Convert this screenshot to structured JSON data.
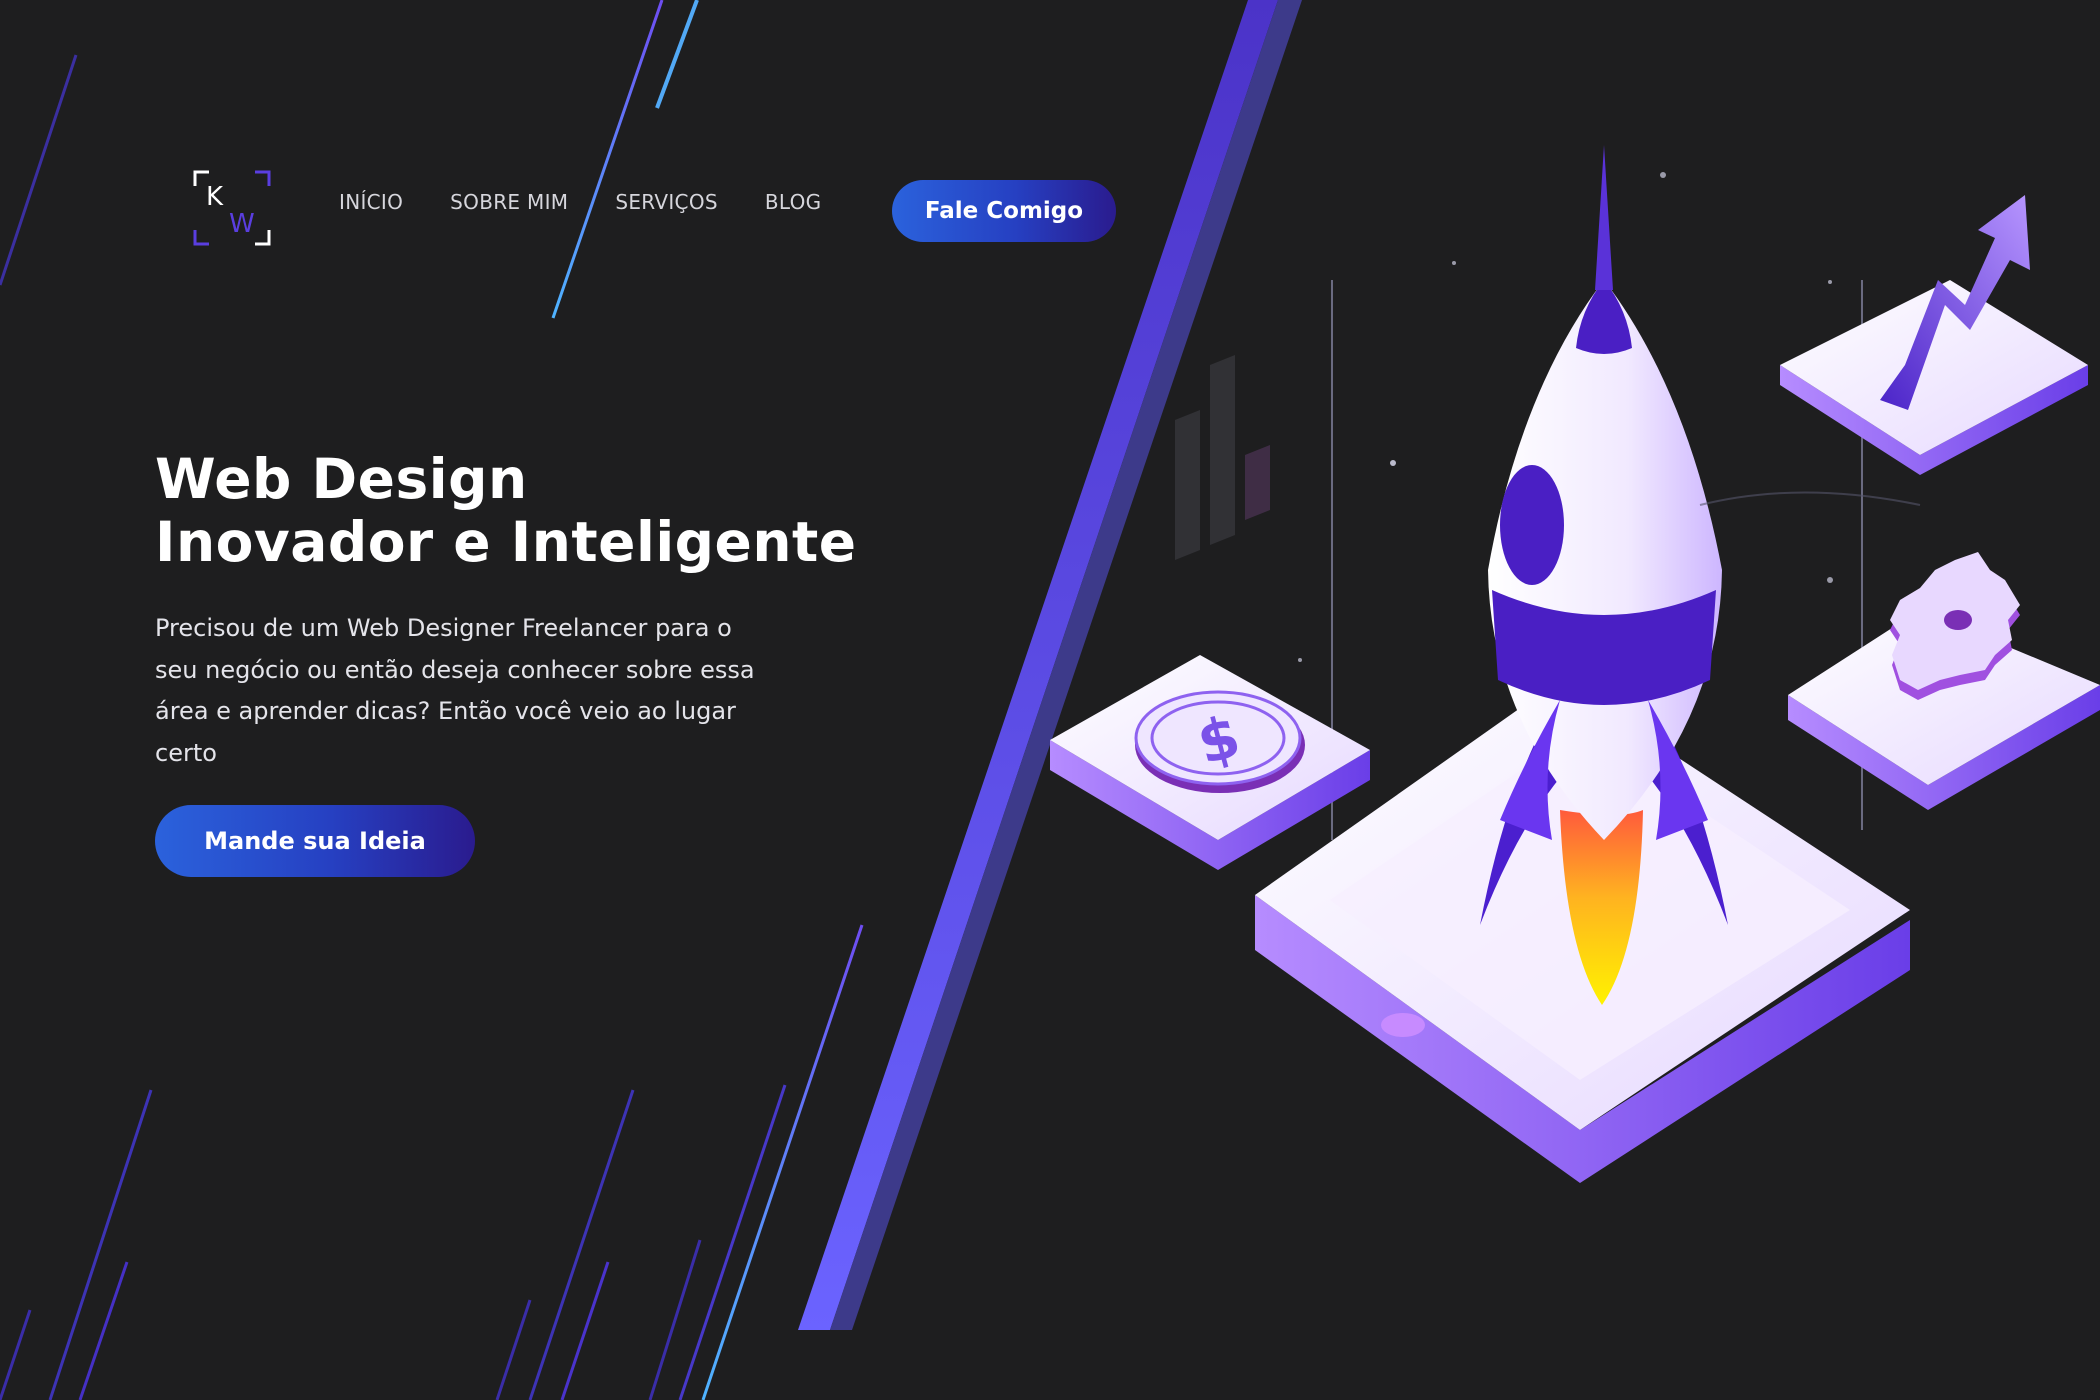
{
  "header": {
    "logo_letters": "KW",
    "nav": [
      {
        "label": "INÍCIO"
      },
      {
        "label": "SOBRE MIM"
      },
      {
        "label": "SERVIÇOS"
      },
      {
        "label": "BLOG"
      }
    ],
    "cta_label": "Fale Comigo"
  },
  "hero": {
    "title_line1": "Web Design",
    "title_line2": "Inovador e Inteligente",
    "description": "Precisou de um Web Designer Freelancer para o seu negócio ou então deseja conhecer sobre essa área e aprender dicas? Então você veio ao lugar certo",
    "cta_label": "Mande sua Ideia"
  },
  "illustration": {
    "icons": [
      "rocket-icon",
      "dollar-coin-icon",
      "growth-arrow-icon",
      "gear-icon",
      "bar-chart-icon"
    ]
  },
  "colors": {
    "background": "#1e1e1f",
    "accent_purple": "#6a4cf0",
    "accent_blue": "#2b62dc",
    "button_gradient_end": "#2a1b8e"
  }
}
